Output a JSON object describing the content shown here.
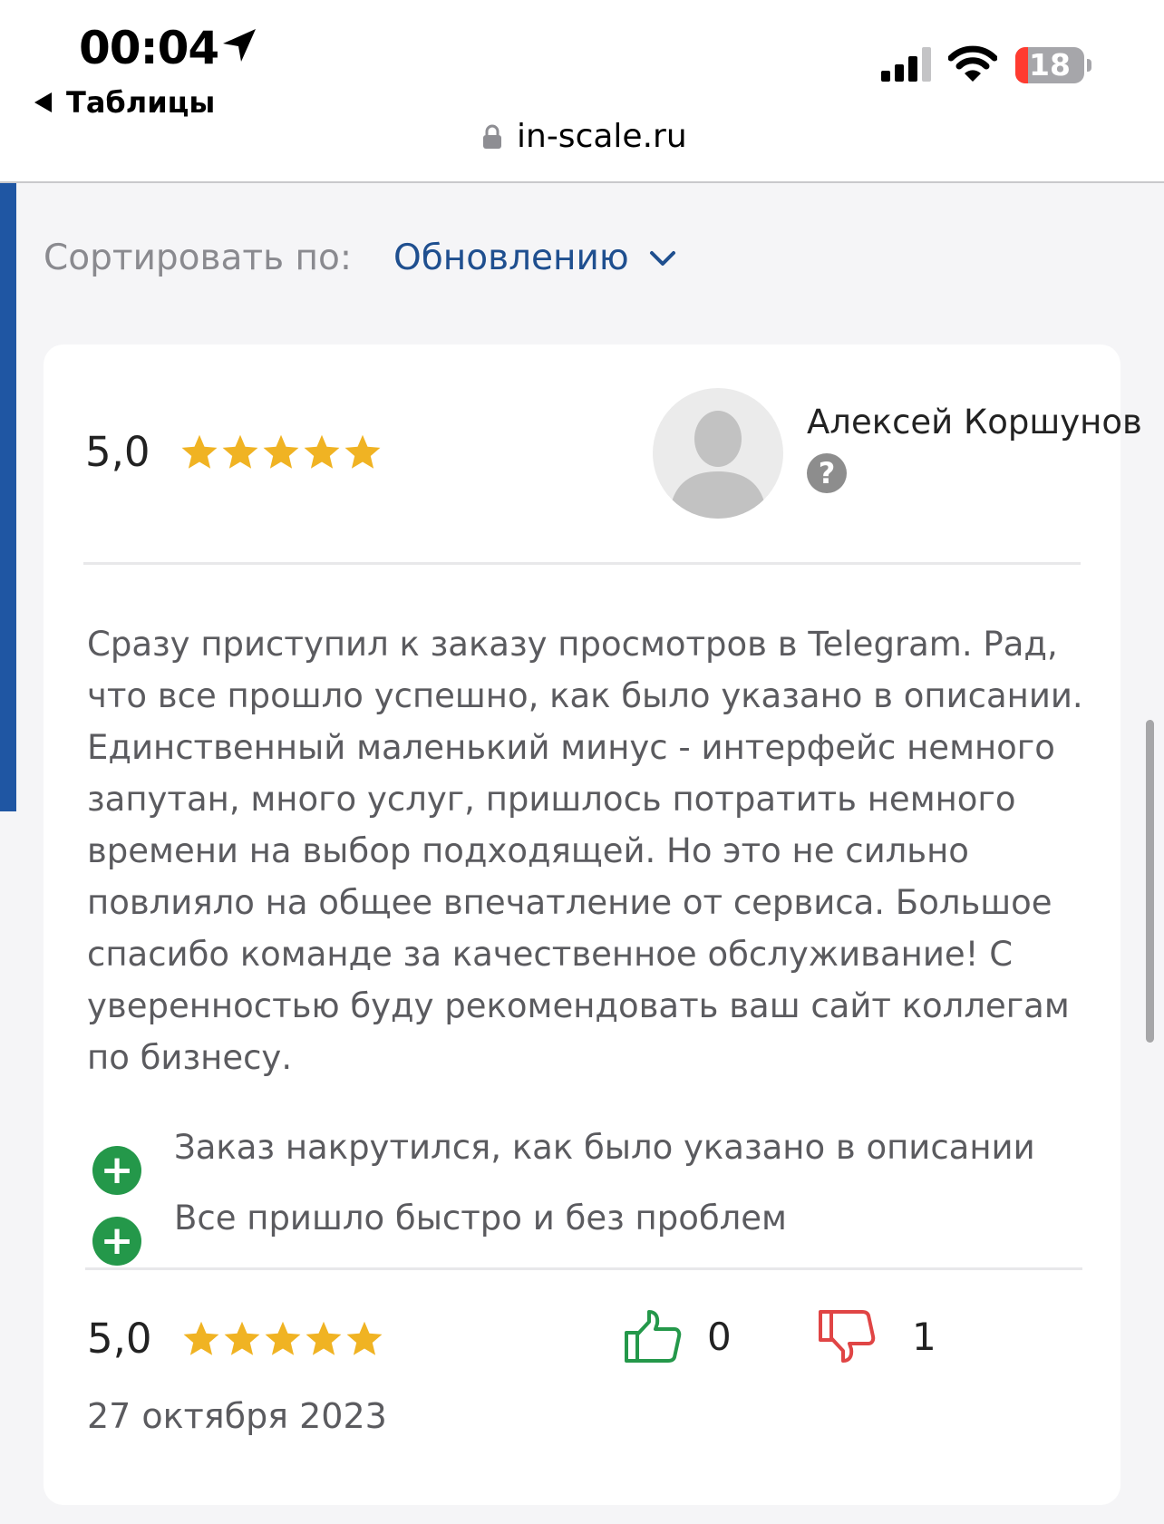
{
  "status_bar": {
    "time": "00:04",
    "back_label": "Таблицы",
    "battery_level": "18",
    "battery_fraction": 0.18,
    "battery_color": "#ff3b30"
  },
  "browser": {
    "url": "in-scale.ru"
  },
  "sort": {
    "label": "Сортировать по:",
    "value": "Обновлению"
  },
  "review": {
    "rating": "5,0",
    "stars": 5,
    "author": "Алексей Коршунов",
    "help_symbol": "?",
    "text": "Сразу приступил к заказу просмотров в Telegram. Рад, что все прошло успешно, как было указано в описании. Единственный маленький минус - интерфейс немного запутан, много услуг, пришлось потратить немного времени на выбор подходящей. Но это не сильно повлияло на общее впечатление от сервиса. Большое спасибо команде за качественное обслуживание! С уверенностью буду рекомендовать ваш сайт коллегам по бизнесу.",
    "pros": [
      {
        "icon": "plus-icon",
        "text": "Заказ накрутился, как было указано в описании"
      },
      {
        "icon": "plus-icon",
        "text": "Все пришло быстро и без проблем"
      }
    ],
    "footer_rating": "5,0",
    "footer_stars": 5,
    "likes": "0",
    "dislikes": "1",
    "date": "27 октября 2023"
  },
  "colors": {
    "accent": "#1f56a3",
    "star": "#f0b323",
    "plus": "#24984a",
    "thumb_up": "#24984a",
    "thumb_down": "#e04545"
  }
}
